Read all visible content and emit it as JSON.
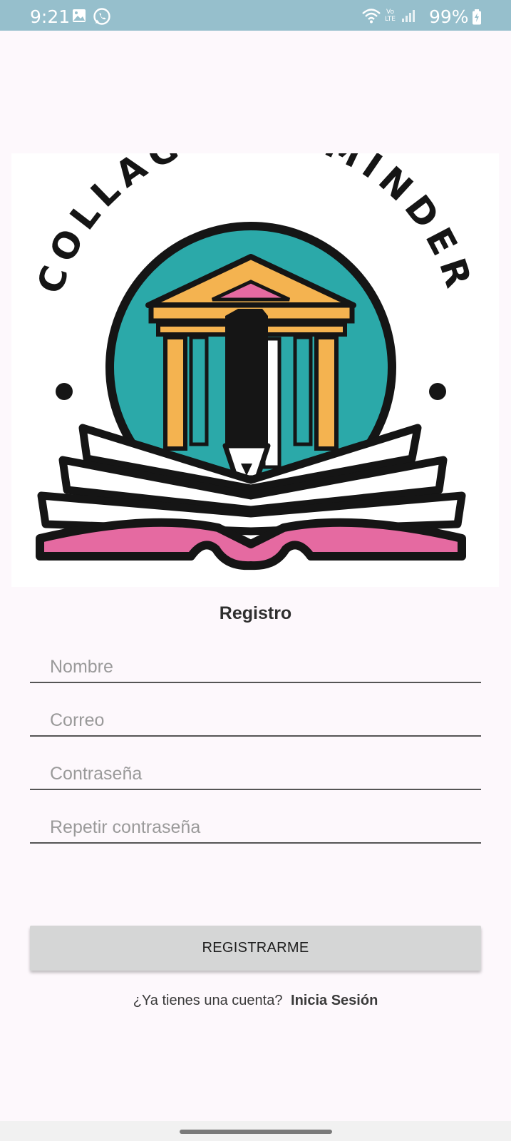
{
  "status_bar": {
    "time": "9:21",
    "battery": "99%",
    "icons": [
      "gallery-icon",
      "whatsapp-icon",
      "wifi-icon",
      "volte-icon",
      "signal-icon",
      "battery-charging-icon"
    ],
    "volte_top": "Vo",
    "volte_bottom": "LTE"
  },
  "logo": {
    "text": "COLLAGE—REMINDER",
    "colors": {
      "teal": "#2ba9a9",
      "orange": "#f4b350",
      "pink": "#e56aa1",
      "black": "#151515"
    }
  },
  "form": {
    "title": "Registro",
    "name_placeholder": "Nombre",
    "email_placeholder": "Correo",
    "password_placeholder": "Contraseña",
    "repeat_password_placeholder": "Repetir contraseña",
    "submit_label": "REGISTRARME",
    "login_prompt": "¿Ya tienes una cuenta?",
    "login_link": "Inicia Sesión"
  }
}
